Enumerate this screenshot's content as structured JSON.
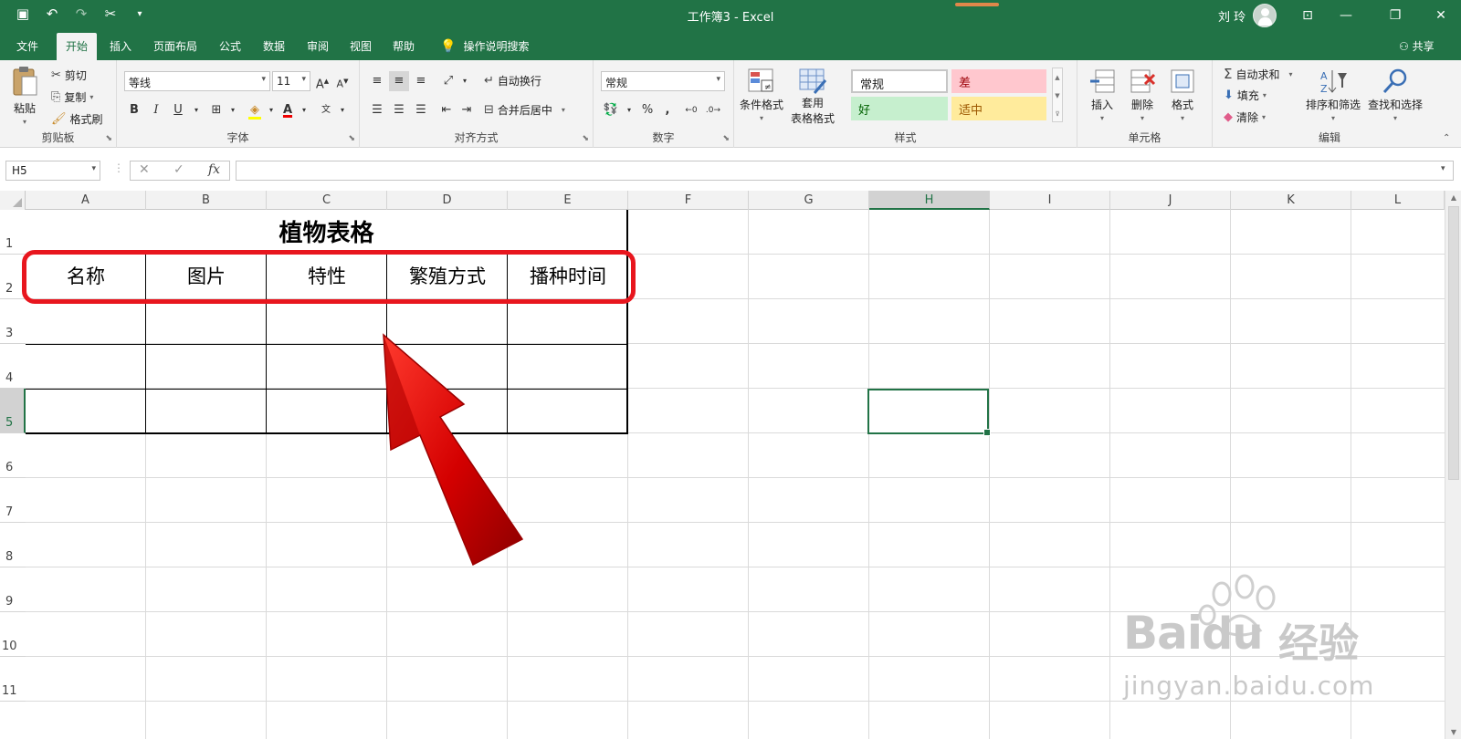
{
  "window": {
    "title": "工作簿3  -  Excel",
    "user": "刘 玲"
  },
  "tabs": [
    "文件",
    "开始",
    "插入",
    "页面布局",
    "公式",
    "数据",
    "审阅",
    "视图",
    "帮助"
  ],
  "tell_me": "操作说明搜索",
  "share": "共享",
  "ribbon": {
    "clipboard": {
      "paste": "粘贴",
      "cut": "剪切",
      "copy": "复制",
      "format_painter": "格式刷",
      "label": "剪贴板"
    },
    "font": {
      "name": "等线",
      "size": "11",
      "label": "字体"
    },
    "alignment": {
      "wrap": "自动换行",
      "merge": "合并后居中",
      "label": "对齐方式"
    },
    "number": {
      "format": "常规",
      "label": "数字"
    },
    "styles": {
      "conditional": "条件格式",
      "table_line1": "套用",
      "table_line2": "表格格式",
      "normal": "常规",
      "bad": "差",
      "good": "好",
      "neutral": "适中",
      "label": "样式"
    },
    "cells": {
      "insert": "插入",
      "delete": "删除",
      "format": "格式",
      "label": "单元格"
    },
    "editing": {
      "autosum": "自动求和",
      "fill": "填充",
      "clear": "清除",
      "sort": "排序和筛选",
      "find": "查找和选择",
      "label": "编辑"
    }
  },
  "formula_bar": {
    "name_box": "H5",
    "fx": "fx"
  },
  "sheet": {
    "columns": [
      "A",
      "B",
      "C",
      "D",
      "E",
      "F",
      "G",
      "H",
      "I",
      "J",
      "K",
      "L"
    ],
    "rows": [
      "1",
      "2",
      "3",
      "4",
      "5",
      "6",
      "7",
      "8",
      "9",
      "10",
      "11"
    ],
    "selected_column": "H",
    "selected_row": "5",
    "title": "植物表格",
    "headers": [
      "名称",
      "图片",
      "特性",
      "繁殖方式",
      "播种时间"
    ]
  },
  "watermark": {
    "brand": "Bai",
    "suffix": "经验",
    "url": "jingyan.baidu.com"
  },
  "colors": {
    "excel_green": "#217346",
    "annotation_red": "#e8161e",
    "arrow_red": "#d40000"
  }
}
